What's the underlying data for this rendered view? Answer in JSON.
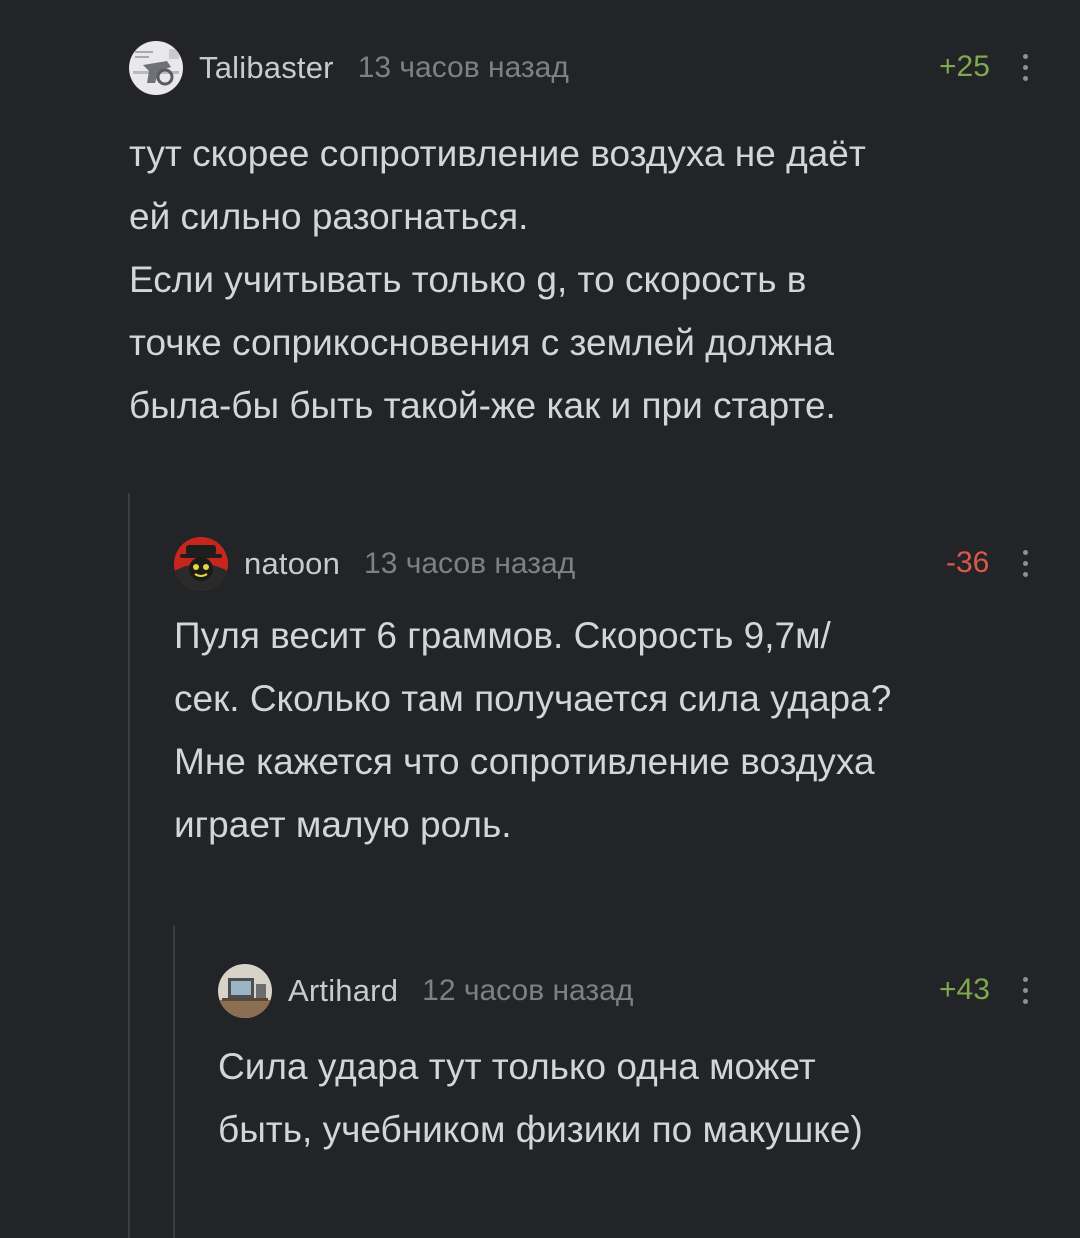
{
  "comments": [
    {
      "author": "Talibaster",
      "time": "13 часов назад",
      "rating": "+25",
      "lines": [
        "тут скорее сопротивление воздуха не даёт",
        "ей сильно разогнаться.",
        "Если учитывать только g, то скорость в",
        "точке соприкосновения с землей должна",
        "была-бы быть такой-же как и при старте."
      ]
    },
    {
      "author": "natoon",
      "time": "13 часов назад",
      "rating": "-36",
      "lines": [
        "Пуля весит 6 граммов. Скорость 9,7м/",
        "сек. Сколько там получается сила удара?",
        "Мне кажется что сопротивление воздуха",
        "играет малую роль."
      ]
    },
    {
      "author": "Artihard",
      "time": "12 часов назад",
      "rating": "+43",
      "lines": [
        "Сила удара тут только одна может",
        "быть, учебником физики по макушке)"
      ]
    }
  ],
  "colors": {
    "background": "#222428",
    "positive": "#7fa84d",
    "negative": "#d9584a"
  },
  "icons": [
    "more-vertical-icon",
    "avatar"
  ]
}
